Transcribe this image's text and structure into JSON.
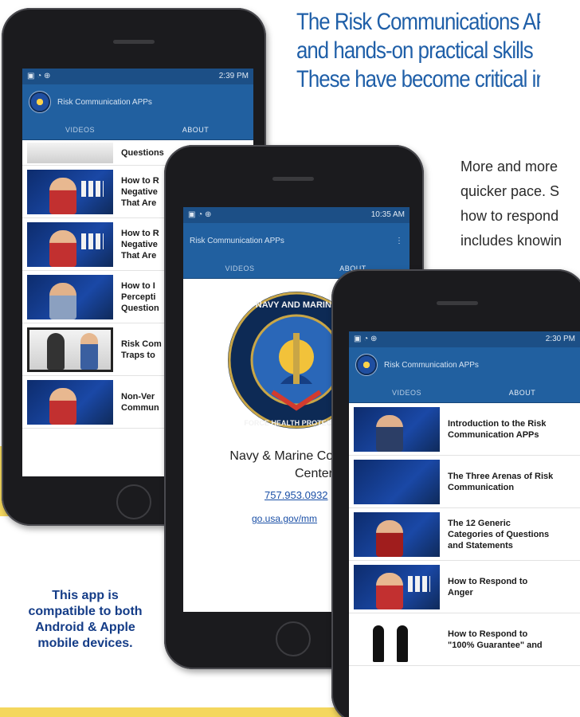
{
  "headline": {
    "line1": "The Risk Communications AP",
    "line2": "and hands-on practical skills",
    "line3": "These have become critical in"
  },
  "paragraph": {
    "line1": "More and more",
    "line2": "quicker pace. S",
    "line3": "how to respond",
    "line4": "includes knowin"
  },
  "compat_text": {
    "line1": "This app is",
    "line2": "compatible to both",
    "line3": "Android & Apple",
    "line4": "mobile devices."
  },
  "phone_left": {
    "time": "2:39 PM",
    "app_title": "Risk Communication APPs",
    "tab_videos": "VIDEOS",
    "tab_about": "ABOUT",
    "items": [
      {
        "line1": "Questions",
        "line2": ""
      },
      {
        "line1": "How to R",
        "line2": "Negative",
        "line3": "That Are"
      },
      {
        "line1": "How to R",
        "line2": "Negative",
        "line3": "That Are"
      },
      {
        "line1": "How to I",
        "line2": "Percepti",
        "line3": "Question"
      },
      {
        "line1": "Risk Com",
        "line2": "Traps to",
        "line3": ""
      },
      {
        "line1": "Non-Ver",
        "line2": "Commun",
        "line3": ""
      }
    ]
  },
  "phone_mid": {
    "time": "10:35 AM",
    "app_title": "Risk Communication APPs",
    "tab_videos": "VIDEOS",
    "tab_about": "ABOUT",
    "seal_top": "NAVY AND MARINE",
    "seal_left": "FORCE HEALTH PROTECTION",
    "org_name_1": "Navy & Marine Corps P",
    "org_name_2": "Center",
    "phone_link": "757.953.0932",
    "web_link": "go.usa.gov/mm"
  },
  "phone_right": {
    "time": "2:30 PM",
    "app_title": "Risk Communication APPs",
    "tab_videos": "VIDEOS",
    "tab_about": "ABOUT",
    "items": [
      {
        "line1": "Introduction to the Risk",
        "line2": "Communication APPs",
        "line3": ""
      },
      {
        "line1": "The Three Arenas of Risk",
        "line2": "Communication",
        "line3": ""
      },
      {
        "line1": "The 12 Generic",
        "line2": "Categories of Questions",
        "line3": "and Statements"
      },
      {
        "line1": "How to Respond to",
        "line2": "Anger",
        "line3": ""
      },
      {
        "line1": "How to Respond to",
        "line2": "\"100% Guarantee\" and",
        "line3": ""
      }
    ]
  },
  "colors": {
    "headline_blue": "#1f5fa8",
    "appbar_blue": "#2160a0",
    "compat_blue": "#143c87",
    "accent_yellow": "#f4d75e"
  }
}
